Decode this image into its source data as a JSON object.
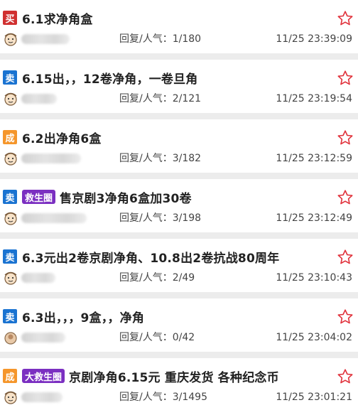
{
  "colors": {
    "sell": "#1a73d1",
    "buy": "#d03030",
    "done": "#f5962b",
    "group": "#7b2fc1",
    "star": "#e0303a"
  },
  "reply_label": "回复/人气：",
  "posts": [
    {
      "type": "买",
      "type_color": "#d03030",
      "group": "",
      "title": "6.1求净角盒",
      "reply": "1/180",
      "time": "11/25 23:39:09"
    },
    {
      "type": "卖",
      "type_color": "#1a73d1",
      "group": "",
      "title": "6.15出，，12卷净角，一卷旦角",
      "reply": "2/121",
      "time": "11/25 23:19:54"
    },
    {
      "type": "成",
      "type_color": "#f5962b",
      "group": "",
      "title": "6.2出净角6盒",
      "reply": "3/182",
      "time": "11/25 23:12:59"
    },
    {
      "type": "卖",
      "type_color": "#1a73d1",
      "group": "救生圈",
      "title": "售京剧3净角6盒加30卷",
      "reply": "3/198",
      "time": "11/25 23:12:49"
    },
    {
      "type": "卖",
      "type_color": "#1a73d1",
      "group": "",
      "title": "6.3元出2卷京剧净角、10.8出2卷抗战80周年",
      "reply": "2/49",
      "time": "11/25 23:10:43"
    },
    {
      "type": "卖",
      "type_color": "#1a73d1",
      "group": "",
      "title": "6.3出，，，9盒，，净角",
      "reply": "0/42",
      "time": "11/25 23:04:02"
    },
    {
      "type": "成",
      "type_color": "#f5962b",
      "group": "大救生圈",
      "title": "京剧净角6.15元 重庆发货 各种纪念币",
      "reply": "3/1495",
      "time": "11/25 23:01:21"
    }
  ]
}
